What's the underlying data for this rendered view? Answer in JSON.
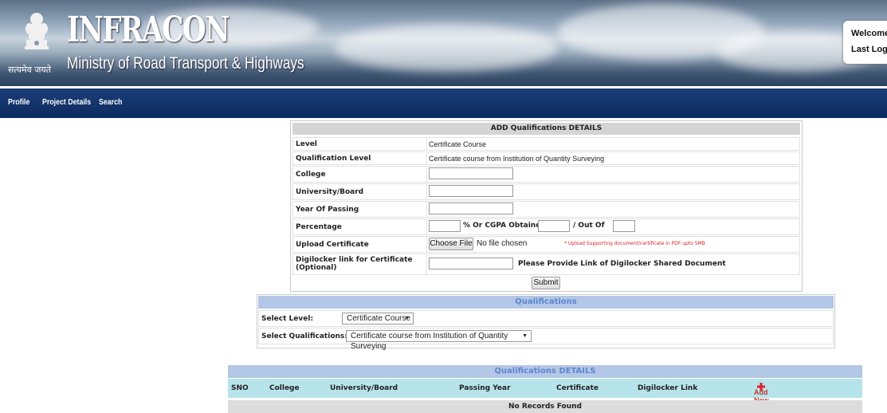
{
  "header": {
    "brand": "INFRACON",
    "ministry": "Ministry of Road Transport & Highways",
    "motto": "सत्यमेव जयते",
    "welcome_label": "Welcome :",
    "last_login_label": "Last Login"
  },
  "nav": {
    "items": [
      {
        "label": "Profile"
      },
      {
        "label": "Project Details"
      },
      {
        "label": "Search"
      }
    ]
  },
  "form": {
    "title": "ADD Qualifications DETAILS",
    "level_label": "Level",
    "level_value": "Certificate Course",
    "qualification_level_label": "Qualification Level",
    "qualification_level_value": "Certificate course from Institution of Quantity Surveying",
    "college_label": "College",
    "university_label": "University/Board",
    "year_label": "Year Of Passing",
    "percentage_label": "Percentage",
    "cgpa_label": "% Or CGPA Obtained",
    "out_of_label": "/ Out Of",
    "upload_label": "Upload Certificate",
    "choose_file_label": "Choose File",
    "no_file_text": "No file chosen",
    "upload_hint": "* Upload Supporting document/certificate in PDF upto 5MB",
    "digilocker_label": "Digilocker link for Certificate (Optional)",
    "digilocker_hint": "Please Provide Link of Digilocker Shared Document",
    "submit_label": "Submit"
  },
  "qualifications": {
    "title": "Qualifications",
    "select_level_label": "Select Level:",
    "select_level_value": "Certificate Course",
    "select_qual_label": "Select Qualifications:",
    "select_qual_value": "Certificate course from Institution of Quantity Surveying"
  },
  "details": {
    "title": "Qualifications DETAILS",
    "columns": [
      "SNO",
      "College",
      "University/Board",
      "Passing Year",
      "Certificate",
      "Digilocker Link"
    ],
    "add_new_label": "Add New",
    "empty_text": "No Records Found"
  },
  "colors": {
    "nav_bg": "#0b2a5e",
    "section_head_bg": "#b3c7e6",
    "section_head_text": "#5d86cf",
    "column_header_bg": "#b7e4ea",
    "add_new_text": "#c0392b"
  }
}
